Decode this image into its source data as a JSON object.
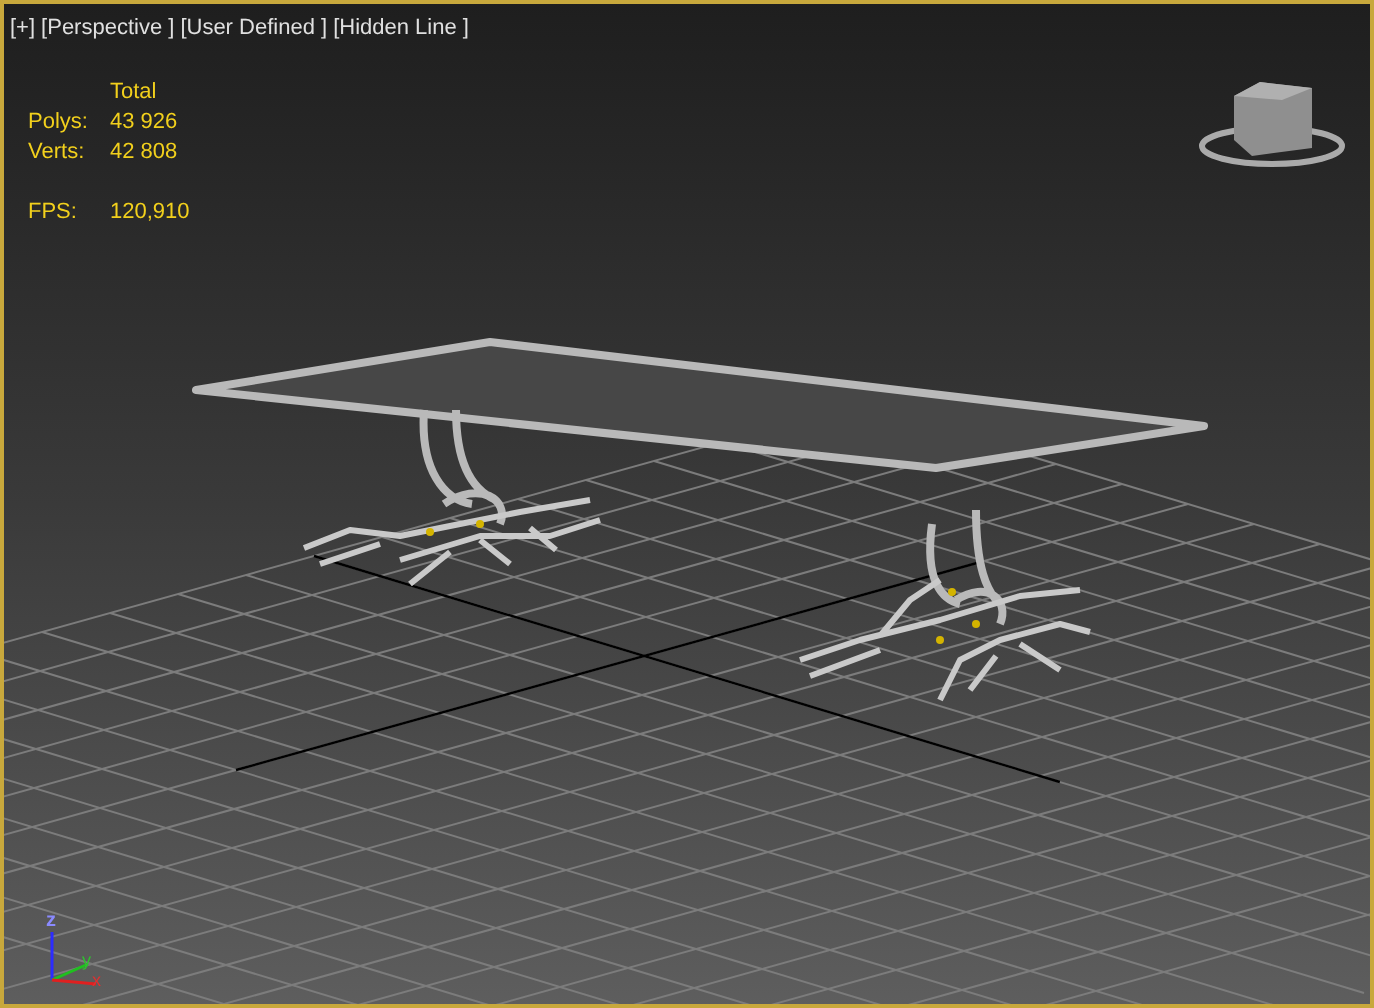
{
  "viewport": {
    "active": true,
    "labels": [
      {
        "text": "[+]"
      },
      {
        "text": "[Perspective ]"
      },
      {
        "text": "[User Defined ]"
      },
      {
        "text": "[Hidden Line ]"
      }
    ],
    "stats": {
      "heading": "Total",
      "rows": [
        {
          "label": "Polys:",
          "value": "43 926"
        },
        {
          "label": "Verts:",
          "value": "42 808"
        }
      ],
      "fps_label": "FPS:",
      "fps_value": "120,910"
    },
    "axis_labels": [
      "z",
      "y",
      "x"
    ]
  }
}
